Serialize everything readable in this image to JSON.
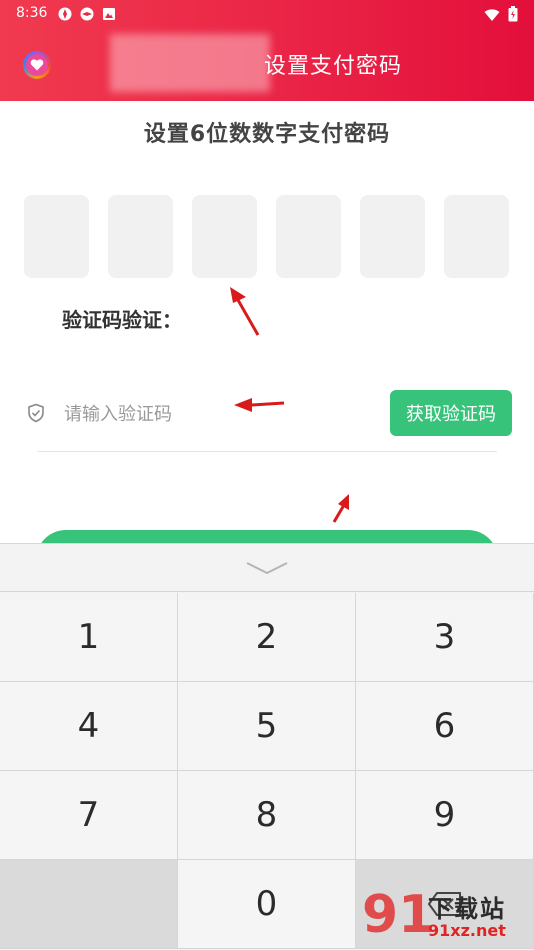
{
  "status_bar": {
    "time": "8:36"
  },
  "header": {
    "title": "设置支付密码"
  },
  "instruction": "设置6位数数字支付密码",
  "pin_box_count": 6,
  "verify": {
    "label": "验证码验证：",
    "placeholder": "请输入验证码",
    "value": "",
    "get_code_label": "获取验证码"
  },
  "keyboard": {
    "keys": [
      "1",
      "2",
      "3",
      "4",
      "5",
      "6",
      "7",
      "8",
      "9",
      "0"
    ]
  },
  "watermark": {
    "brand": "下载站",
    "url": "91xz.net",
    "mark": "91"
  },
  "colors": {
    "header_red": "#ea2446",
    "accent_green": "#37c47a",
    "pin_box": "#f1f1f1",
    "keyboard_bg": "#f3f3f3",
    "arrow_red": "#d91a1a"
  }
}
